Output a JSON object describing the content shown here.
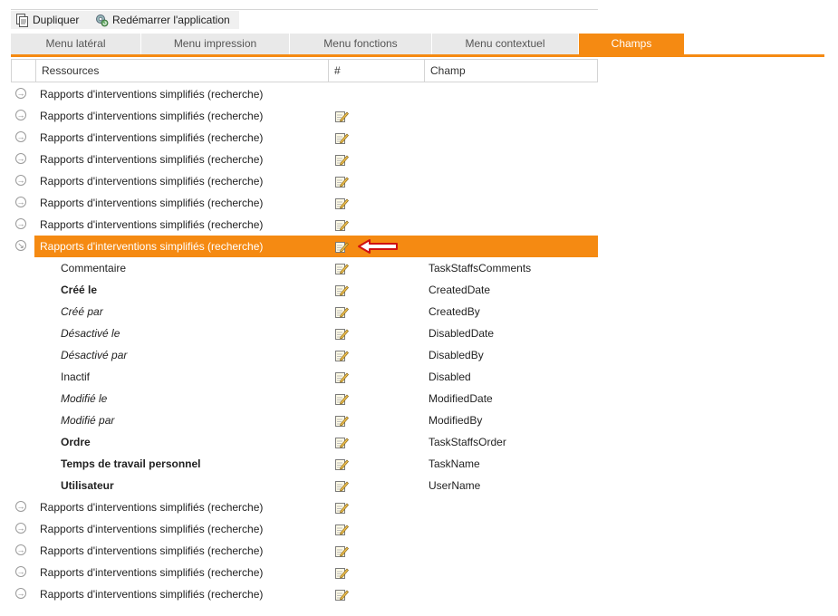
{
  "toolbar": {
    "duplicate_label": "Dupliquer",
    "restart_label": "Redémarrer l'application"
  },
  "tabs": [
    {
      "label": "Menu latéral",
      "active": false
    },
    {
      "label": "Menu impression",
      "active": false
    },
    {
      "label": "Menu fonctions",
      "active": false
    },
    {
      "label": "Menu contextuel",
      "active": false
    },
    {
      "label": "Champs",
      "active": true
    }
  ],
  "grid": {
    "headers": [
      "Ressources",
      "#",
      "Champ"
    ]
  },
  "rows_top": [
    {
      "label": "Rapports d'interventions simplifiés (recherche)",
      "has_edit": false
    },
    {
      "label": "Rapports d'interventions simplifiés (recherche)",
      "has_edit": true
    },
    {
      "label": "Rapports d'interventions simplifiés (recherche)",
      "has_edit": true
    },
    {
      "label": "Rapports d'interventions simplifiés (recherche)",
      "has_edit": true
    },
    {
      "label": "Rapports d'interventions simplifiés (recherche)",
      "has_edit": true
    },
    {
      "label": "Rapports d'interventions simplifiés (recherche)",
      "has_edit": true
    },
    {
      "label": "Rapports d'interventions simplifiés (recherche)",
      "has_edit": true
    }
  ],
  "selected_row": {
    "label": "Rapports d'interventions simplifiés (recherche)"
  },
  "children": [
    {
      "label": "Commentaire",
      "field": "TaskStaffsComments",
      "style": "normal"
    },
    {
      "label": "Créé le",
      "field": "CreatedDate",
      "style": "bold"
    },
    {
      "label": "Créé par",
      "field": "CreatedBy",
      "style": "italic"
    },
    {
      "label": "Désactivé le",
      "field": "DisabledDate",
      "style": "italic"
    },
    {
      "label": "Désactivé par",
      "field": "DisabledBy",
      "style": "italic"
    },
    {
      "label": "Inactif",
      "field": "Disabled",
      "style": "normal"
    },
    {
      "label": "Modifié le",
      "field": "ModifiedDate",
      "style": "italic"
    },
    {
      "label": "Modifié par",
      "field": "ModifiedBy",
      "style": "italic"
    },
    {
      "label": "Ordre",
      "field": "TaskStaffsOrder",
      "style": "bold"
    },
    {
      "label": "Temps de travail personnel",
      "field": "TaskName",
      "style": "bold"
    },
    {
      "label": "Utilisateur",
      "field": "UserName",
      "style": "bold"
    }
  ],
  "rows_bottom": [
    {
      "label": "Rapports d'interventions simplifiés (recherche)"
    },
    {
      "label": "Rapports d'interventions simplifiés (recherche)"
    },
    {
      "label": "Rapports d'interventions simplifiés (recherche)"
    },
    {
      "label": "Rapports d'interventions simplifiés (recherche)"
    },
    {
      "label": "Rapports d'interventions simplifiés (recherche)"
    }
  ],
  "colors": {
    "accent": "#f58a12",
    "tab_bg": "#e9e9e9"
  },
  "icons": {
    "duplicate": "document-copy-icon",
    "restart": "gear-refresh-icon",
    "edit": "pencil-note-icon",
    "expand": "circle-arrow-icon",
    "annotation": "red-arrow-icon"
  }
}
